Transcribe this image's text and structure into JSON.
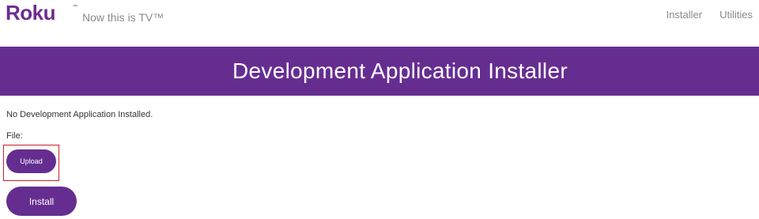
{
  "header": {
    "logo_text": "Roku",
    "logo_tm": "™",
    "tagline": "Now this is TV™",
    "nav": [
      {
        "label": "Installer"
      },
      {
        "label": "Utilities"
      }
    ]
  },
  "banner": {
    "title": "Development Application Installer"
  },
  "main": {
    "status": "No Development Application Installed.",
    "file_label": "File:",
    "upload_label": "Upload",
    "install_label": "Install"
  },
  "colors": {
    "brand_purple": "#662d91",
    "highlight_red": "#d01f2a",
    "text_gray": "#8a8a8a"
  }
}
